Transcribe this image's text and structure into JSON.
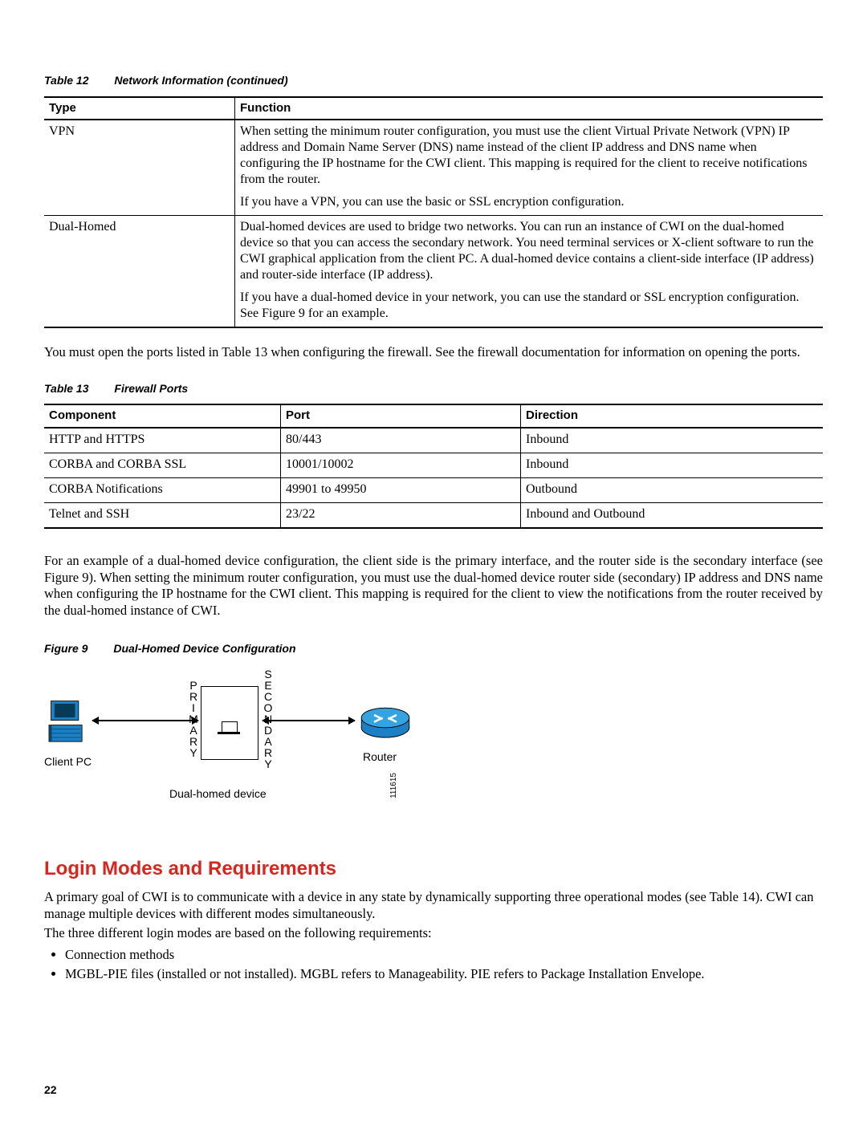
{
  "table12": {
    "caption_label": "Table 12",
    "caption_title": "Network Information (continued)",
    "headers": {
      "type": "Type",
      "function": "Function"
    },
    "rows": [
      {
        "type": "VPN",
        "func_p1": "When setting the minimum router configuration, you must use the client Virtual Private Network (VPN) IP address and Domain Name Server (DNS) name instead of the client IP address and DNS name when configuring the IP hostname for the CWI client. This mapping is required for the client to receive notifications from the router.",
        "func_p2": "If you have a VPN, you can use the basic or SSL encryption configuration."
      },
      {
        "type": "Dual-Homed",
        "func_p1": "Dual-homed devices are used to bridge two networks. You can run an instance of CWI on the dual-homed device so that you can access the secondary network. You need terminal services or X-client software to run the CWI graphical application from the client PC. A dual-homed device contains a client-side interface (IP address) and router-side interface (IP address).",
        "func_p2": "If you have a dual-homed device in your network, you can use the standard or SSL encryption configuration. See Figure 9 for an example."
      }
    ]
  },
  "para_after_t12": "You must open the ports listed in Table 13 when configuring the firewall. See the firewall documentation for information on opening the ports.",
  "table13": {
    "caption_label": "Table 13",
    "caption_title": "Firewall Ports",
    "headers": {
      "component": "Component",
      "port": "Port",
      "direction": "Direction"
    },
    "rows": [
      {
        "component": "HTTP and HTTPS",
        "port": "80/443",
        "direction": "Inbound"
      },
      {
        "component": "CORBA and CORBA SSL",
        "port": "10001/10002",
        "direction": "Inbound"
      },
      {
        "component": "CORBA Notifications",
        "port": "49901 to 49950",
        "direction": "Outbound"
      },
      {
        "component": "Telnet and SSH",
        "port": "23/22",
        "direction": "Inbound and Outbound"
      }
    ]
  },
  "para_after_t13": "For an example of a dual-homed device configuration, the client side is the primary interface, and the router side is the secondary interface (see Figure 9). When setting the minimum router configuration, you must use the dual-homed device router side (secondary) IP address and DNS name when configuring the IP hostname for the CWI client. This mapping is required for the client to view the notifications from the router received by the dual-homed instance of CWI.",
  "figure9": {
    "caption_label": "Figure 9",
    "caption_title": "Dual-Homed Device Configuration",
    "client_label": "Client PC",
    "primary_letters": "PRIMARY",
    "secondary_letters": "SECONDARY",
    "device_label": "Dual-homed device",
    "router_label": "Router",
    "fig_id": "111615"
  },
  "section": {
    "heading": "Login Modes and Requirements",
    "p1": "A primary goal of CWI is to communicate with a device in any state by dynamically supporting three operational modes (see Table 14). CWI can manage multiple devices with different modes simultaneously.",
    "p2": "The three different login modes are based on the following requirements:",
    "bullets": [
      "Connection methods",
      "MGBL-PIE files (installed or not installed). MGBL refers to Manageability. PIE refers to Package Installation Envelope."
    ]
  },
  "page_number": "22"
}
